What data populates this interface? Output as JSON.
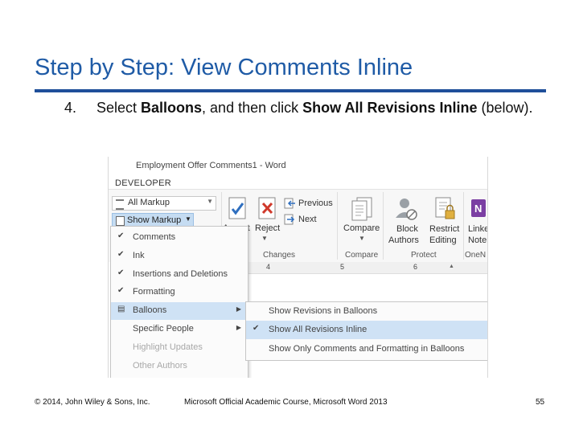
{
  "slide": {
    "title": "Step by Step: View Comments Inline",
    "step_number": "4.",
    "step_parts": [
      "Select ",
      "Balloons",
      ", and then click ",
      "Show All Revisions Inline",
      " (below)."
    ]
  },
  "screenshot": {
    "window_title": "Employment Offer Comments1 - Word",
    "tab": "DEVELOPER",
    "markup_dropdown": "All Markup",
    "show_markup_button": "Show Markup",
    "ribbon": {
      "previous": "Previous",
      "next": "Next",
      "accept": "Accept",
      "reject": "Reject",
      "compare": "Compare",
      "block_authors": [
        "Block",
        "Authors"
      ],
      "restrict_editing": [
        "Restrict",
        "Editing"
      ],
      "linked_notes": [
        "Linke",
        "Note"
      ],
      "groups": [
        "Changes",
        "Compare",
        "Protect",
        "OneN"
      ]
    },
    "ruler_ticks": [
      "4",
      "5",
      "6"
    ],
    "show_markup_menu": [
      {
        "label": "Comments",
        "checked": true,
        "submenu": false,
        "disabled": false,
        "highlighted": false
      },
      {
        "label": "Ink",
        "checked": true,
        "submenu": false,
        "disabled": false,
        "highlighted": false
      },
      {
        "label": "Insertions and Deletions",
        "checked": true,
        "submenu": false,
        "disabled": false,
        "highlighted": false
      },
      {
        "label": "Formatting",
        "checked": true,
        "submenu": false,
        "disabled": false,
        "highlighted": false
      },
      {
        "label": "Balloons",
        "checked": false,
        "submenu": true,
        "disabled": false,
        "highlighted": true
      },
      {
        "label": "Specific People",
        "checked": false,
        "submenu": true,
        "disabled": false,
        "highlighted": false
      },
      {
        "label": "Highlight Updates",
        "checked": false,
        "submenu": false,
        "disabled": true,
        "highlighted": false
      },
      {
        "label": "Other Authors",
        "checked": false,
        "submenu": false,
        "disabled": true,
        "highlighted": false
      }
    ],
    "balloons_submenu": [
      {
        "label": "Show Revisions in Balloons",
        "checked": false,
        "highlighted": false
      },
      {
        "label": "Show All Revisions Inline",
        "checked": true,
        "highlighted": true
      },
      {
        "label": "Show Only Comments and Formatting in Balloons",
        "checked": false,
        "highlighted": false
      }
    ]
  },
  "footer": {
    "copyright": "© 2014, John Wiley & Sons, Inc.",
    "course": "Microsoft Official Academic Course, Microsoft Word 2013",
    "page_number": "55"
  },
  "colors": {
    "title": "#1f5ba6",
    "title_rule": "#1f4f9a",
    "menu_highlight": "#cfe2f5"
  }
}
